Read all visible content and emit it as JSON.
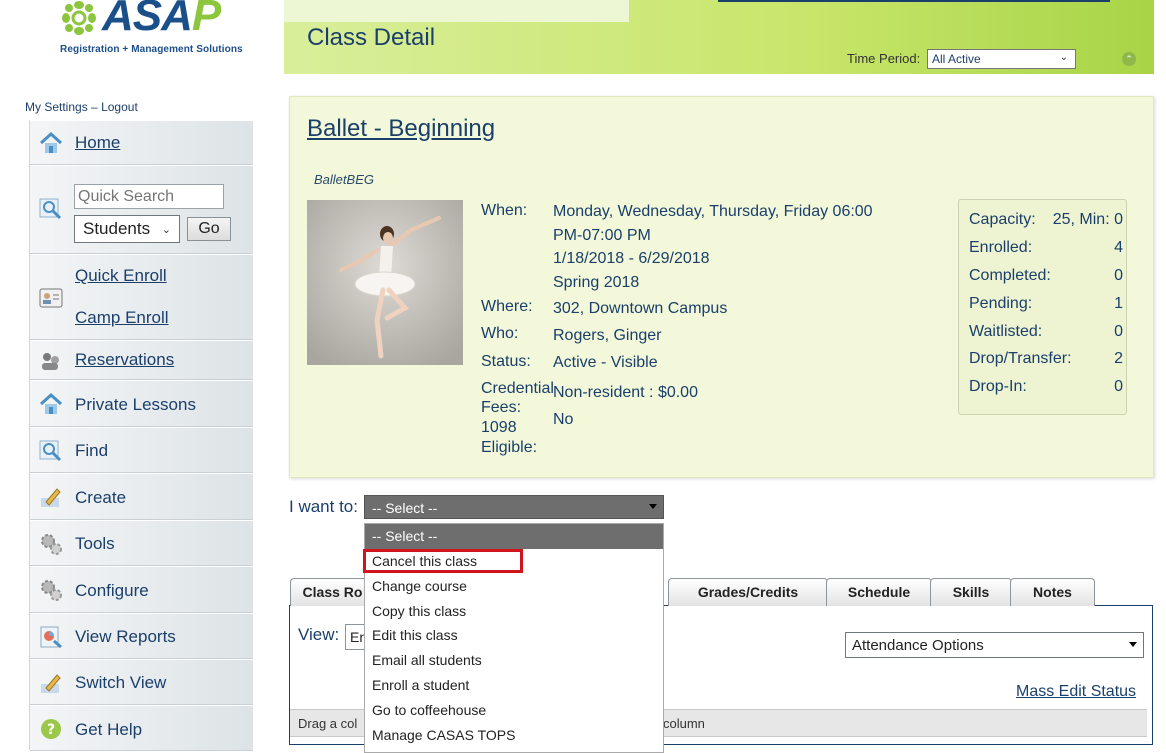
{
  "logo": {
    "name": "ASAP",
    "tagline": "Registration + Management Solutions"
  },
  "user_links": {
    "settings": "My Settings",
    "separator": "–",
    "logout": "Logout"
  },
  "sidebar": {
    "items": [
      {
        "label": "Home",
        "icon": "home-icon"
      },
      {
        "label": "Quick Enroll",
        "icon": "enroll-icon"
      },
      {
        "label": "Camp Enroll",
        "icon": "enroll-icon"
      },
      {
        "label": "Reservations",
        "icon": "reservations-icon"
      },
      {
        "label": "Private Lessons",
        "icon": "home-icon"
      },
      {
        "label": "Find",
        "icon": "magnifier-icon"
      },
      {
        "label": "Create",
        "icon": "pencil-icon"
      },
      {
        "label": "Tools",
        "icon": "gears-icon"
      },
      {
        "label": "Configure",
        "icon": "gears-icon"
      },
      {
        "label": "View Reports",
        "icon": "reports-icon"
      },
      {
        "label": "Switch View",
        "icon": "pencil-icon"
      },
      {
        "label": "Get Help",
        "icon": "help-icon"
      }
    ],
    "quick_search": {
      "placeholder": "Quick Search",
      "category": "Students",
      "go_label": "Go"
    }
  },
  "header": {
    "title": "Class Detail",
    "time_period_label": "Time Period:",
    "time_period_value": "All Active"
  },
  "class": {
    "name": "Ballet - Beginning",
    "code": "BalletBEG",
    "when_label": "When:",
    "when_lines": [
      "Monday, Wednesday, Thursday, Friday 06:00",
      "PM-07:00 PM",
      "1/18/2018 - 6/29/2018",
      "Spring 2018"
    ],
    "where_label": "Where:",
    "where": "302, Downtown Campus",
    "who_label": "Who:",
    "who": "Rogers, Ginger",
    "status_label": "Status:",
    "status": "Active - Visible",
    "credential_fees_label_1": "Credential",
    "credential_fees_label_2": "Fees:",
    "credential_fees": "Non-resident : $0.00",
    "eligible_label_1": "1098",
    "eligible_label_2": "Eligible:",
    "eligible": "No"
  },
  "stats": [
    {
      "label": "Capacity:",
      "value": "25, Min: 0"
    },
    {
      "label": "Enrolled:",
      "value": "4"
    },
    {
      "label": "Completed:",
      "value": "0"
    },
    {
      "label": "Pending:",
      "value": "1"
    },
    {
      "label": "Waitlisted:",
      "value": "0"
    },
    {
      "label": "Drop/Transfer:",
      "value": "2"
    },
    {
      "label": "Drop-In:",
      "value": "0"
    }
  ],
  "actions": {
    "label": "I want to:",
    "selected": "-- Select --",
    "options": [
      "-- Select --",
      "Cancel this class",
      "Change course",
      "Copy this class",
      "Edit this class",
      "Email all students",
      "Enroll a student",
      "Go to coffeehouse",
      "Manage CASAS TOPS"
    ]
  },
  "tabs": [
    "Class Ro",
    "Grades/Credits",
    "Schedule",
    "Skills",
    "Notes"
  ],
  "roster": {
    "view_label": "View:",
    "view_value": "En",
    "attendance_options": "Attendance Options",
    "mass_edit": "Mass Edit Status",
    "grid_hint_left": "Drag a col",
    "grid_hint_right": "column"
  }
}
